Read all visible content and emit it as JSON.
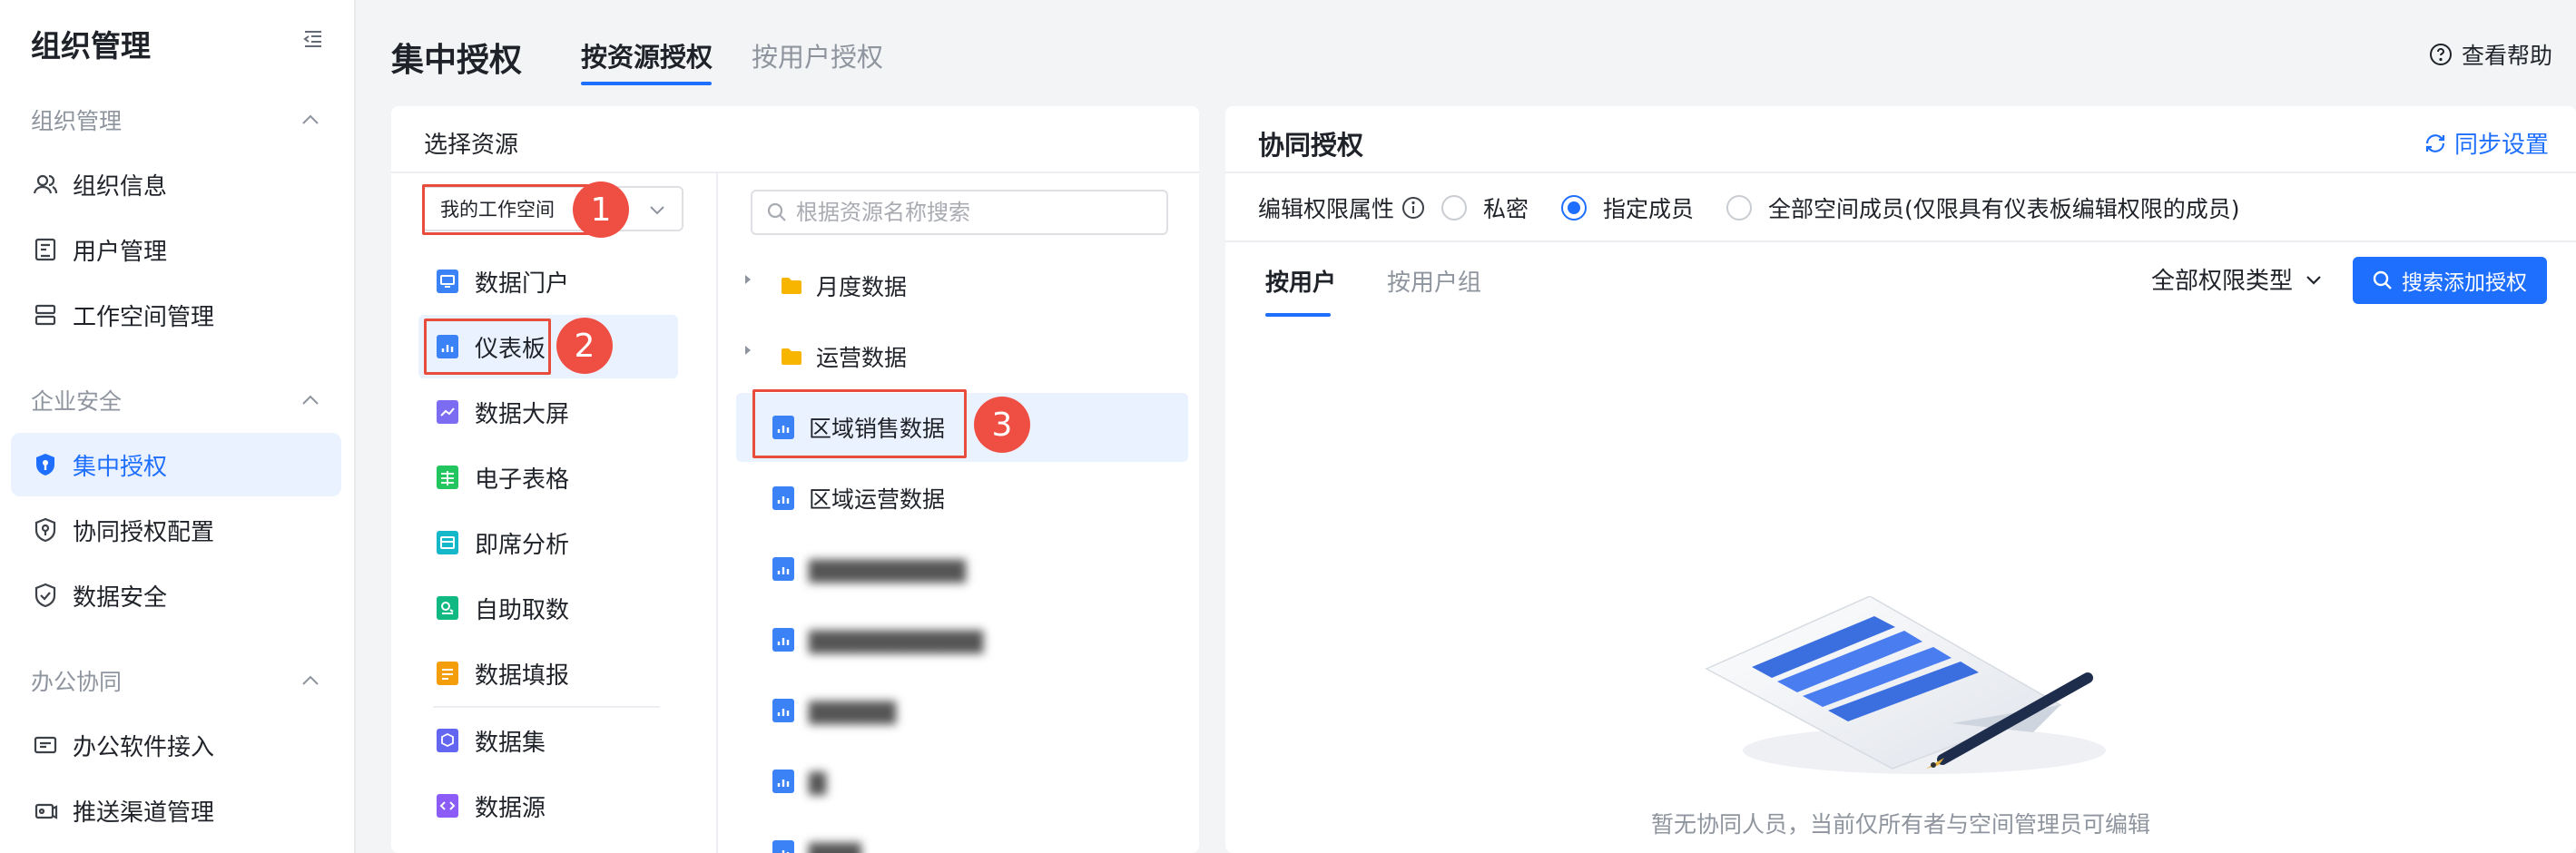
{
  "sidebar": {
    "title": "组织管理",
    "sections": [
      {
        "label": "组织管理",
        "items": [
          {
            "label": "组织信息",
            "icon": "users-icon"
          },
          {
            "label": "用户管理",
            "icon": "user-card-icon"
          },
          {
            "label": "工作空间管理",
            "icon": "workspace-icon"
          }
        ]
      },
      {
        "label": "企业安全",
        "items": [
          {
            "label": "集中授权",
            "icon": "shield-key-icon",
            "active": true
          },
          {
            "label": "协同授权配置",
            "icon": "shield-config-icon"
          },
          {
            "label": "数据安全",
            "icon": "shield-check-icon"
          }
        ]
      },
      {
        "label": "办公协同",
        "items": [
          {
            "label": "办公软件接入",
            "icon": "plug-icon"
          },
          {
            "label": "推送渠道管理",
            "icon": "push-channel-icon"
          }
        ]
      }
    ]
  },
  "header": {
    "title": "集中授权",
    "tabs": [
      {
        "label": "按资源授权",
        "active": true
      },
      {
        "label": "按用户授权",
        "active": false
      }
    ],
    "help": "查看帮助"
  },
  "resource_panel": {
    "title": "选择资源",
    "workspace_select": "我的工作空间",
    "types": [
      {
        "label": "数据门户",
        "icon": "portal-icon",
        "color": "#3b82f6"
      },
      {
        "label": "仪表板",
        "icon": "dashboard-icon",
        "color": "#3b82f6",
        "selected": true
      },
      {
        "label": "数据大屏",
        "icon": "big-screen-icon",
        "color": "#7c6cf2"
      },
      {
        "label": "电子表格",
        "icon": "spreadsheet-icon",
        "color": "#22c55e"
      },
      {
        "label": "即席分析",
        "icon": "adhoc-analysis-icon",
        "color": "#14b8c8"
      },
      {
        "label": "自助取数",
        "icon": "self-service-icon",
        "color": "#10b981"
      },
      {
        "label": "数据填报",
        "icon": "data-entry-icon",
        "color": "#f59e0b"
      },
      {
        "label": "数据集",
        "icon": "dataset-icon",
        "color": "#6366f1"
      },
      {
        "label": "数据源",
        "icon": "datasource-icon",
        "color": "#8b5cf6"
      }
    ],
    "search_placeholder": "根据资源名称搜索",
    "tree": {
      "folders": [
        "月度数据",
        "运营数据"
      ],
      "leaves": [
        "区域销售数据",
        "区域运营数据"
      ],
      "selected_leaf": "区域销售数据"
    },
    "annotations": [
      "1",
      "2",
      "3"
    ]
  },
  "collab_panel": {
    "title": "协同授权",
    "sync_label": "同步设置",
    "edit_perm_label": "编辑权限属性",
    "radio_options": [
      {
        "label": "私密",
        "checked": false
      },
      {
        "label": "指定成员",
        "checked": true
      },
      {
        "label": "全部空间成员(仅限具有仪表板编辑权限的成员)",
        "checked": false
      }
    ],
    "sub_tabs": [
      {
        "label": "按用户",
        "active": true
      },
      {
        "label": "按用户组",
        "active": false
      }
    ],
    "type_filter": "全部权限类型",
    "add_button": "搜索添加授权",
    "empty_text": "暂无协同人员，当前仅所有者与空间管理员可编辑"
  },
  "colors": {
    "accent": "#1f6fff",
    "annotation": "#ef4f43"
  }
}
